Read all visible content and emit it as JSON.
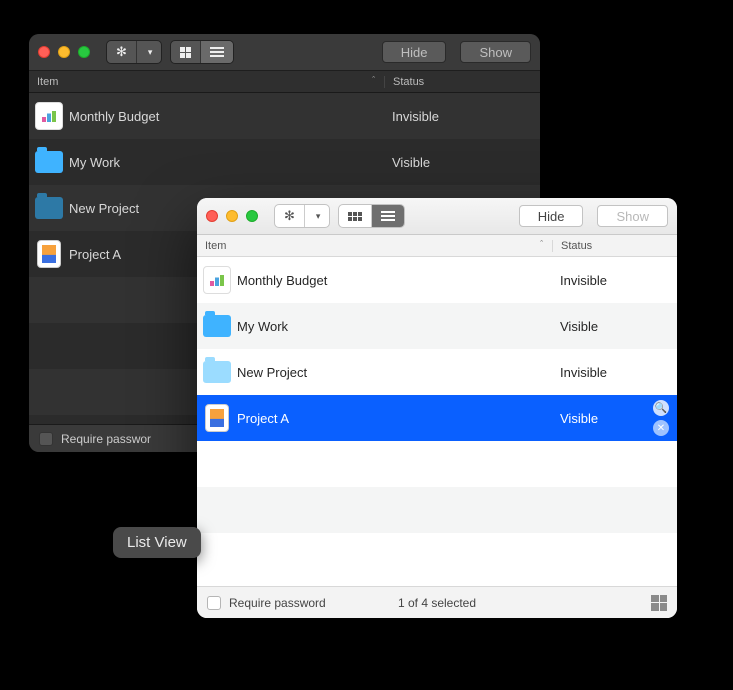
{
  "darkWindow": {
    "toolbar": {
      "hide_label": "Hide",
      "show_label": "Show"
    },
    "columns": {
      "item": "Item",
      "status": "Status"
    },
    "rows": [
      {
        "icon": "chart-icon",
        "name": "Monthly Budget",
        "status": "Invisible"
      },
      {
        "icon": "folder-icon",
        "name": "My Work",
        "status": "Visible"
      },
      {
        "icon": "folder-dark-icon",
        "name": "New Project",
        "status": ""
      },
      {
        "icon": "document-icon",
        "name": "Project A",
        "status": ""
      }
    ],
    "footer": {
      "require_password_label": "Require passwor"
    }
  },
  "lightWindow": {
    "toolbar": {
      "hide_label": "Hide",
      "show_label": "Show"
    },
    "columns": {
      "item": "Item",
      "status": "Status"
    },
    "rows": [
      {
        "icon": "chart-icon",
        "name": "Monthly Budget",
        "status": "Invisible",
        "selected": false
      },
      {
        "icon": "folder-icon",
        "name": "My Work",
        "status": "Visible",
        "selected": false
      },
      {
        "icon": "folder-faded-icon",
        "name": "New Project",
        "status": "Invisible",
        "selected": false
      },
      {
        "icon": "document-icon",
        "name": "Project A",
        "status": "Visible",
        "selected": true
      }
    ],
    "footer": {
      "require_password_label": "Require password",
      "selection_status": "1 of 4 selected"
    }
  },
  "tooltip": {
    "text": "List View"
  }
}
